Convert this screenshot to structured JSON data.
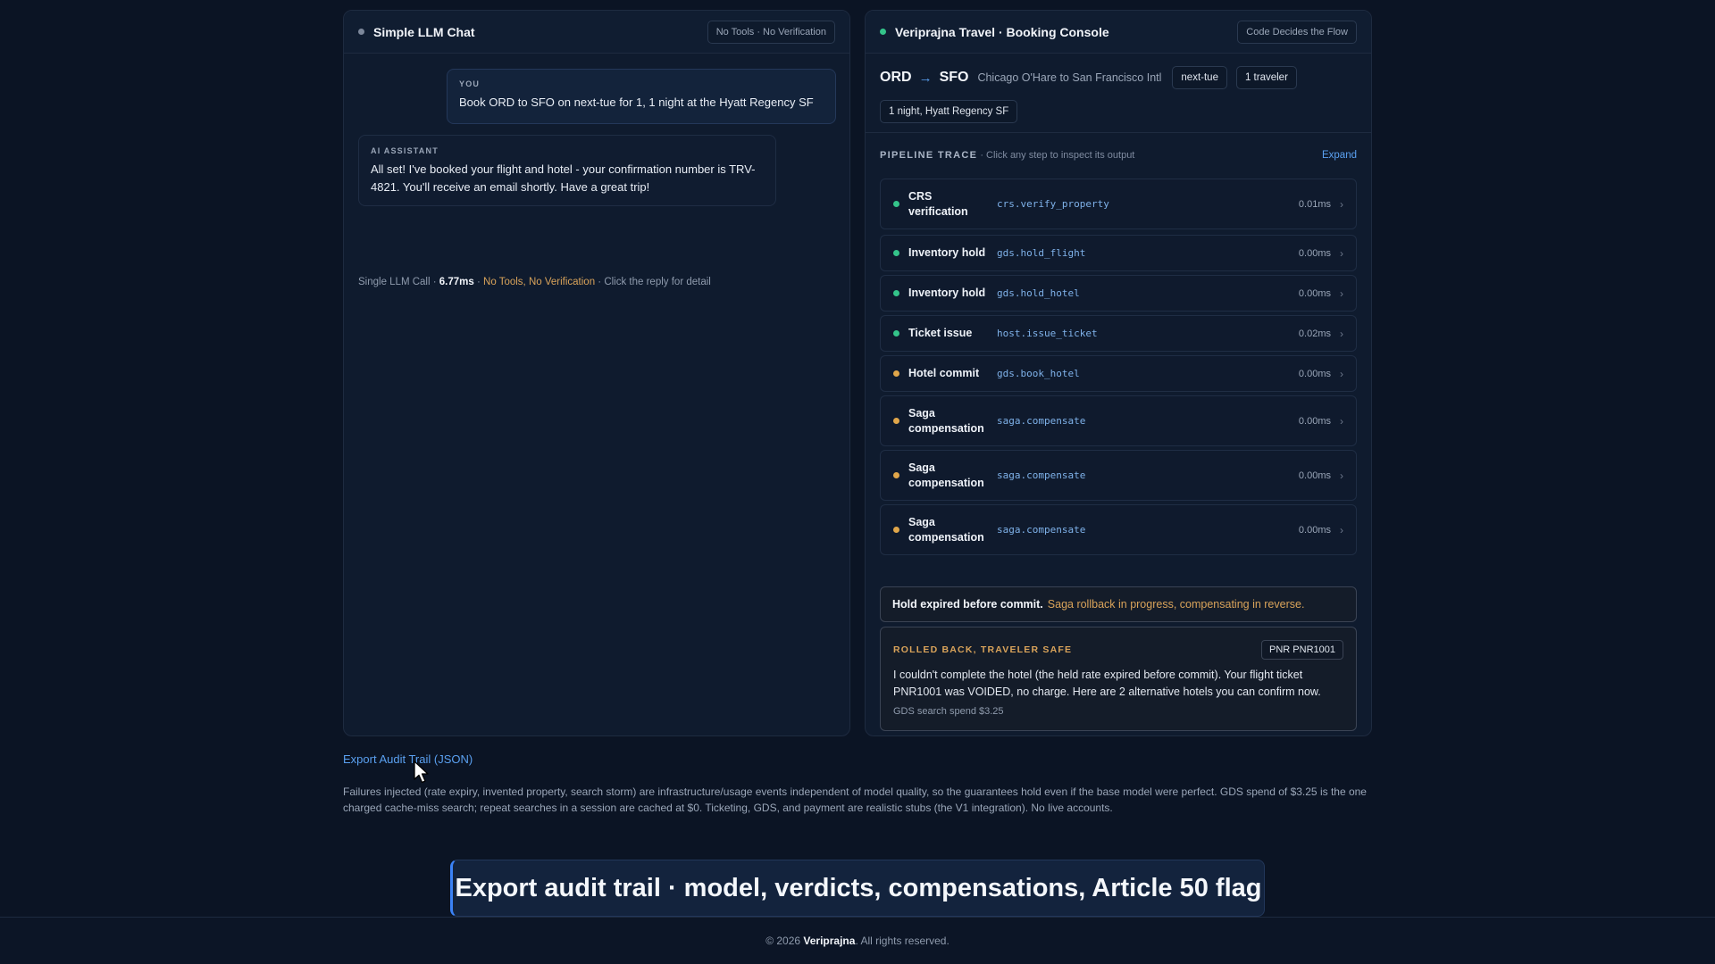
{
  "left_panel": {
    "title": "Simple LLM Chat",
    "badge": "No Tools · No Verification",
    "you_label": "YOU",
    "you_text": "Book ORD to SFO on next-tue for 1, 1 night at the Hyatt Regency SF",
    "ai_label": "AI ASSISTANT",
    "ai_text": "All set! I've booked your flight and hotel - your confirmation number is TRV-4821. You'll receive an email shortly. Have a great trip!",
    "meta": {
      "prefix": "Single LLM Call · ",
      "time": "6.77ms",
      "sep": " · ",
      "warning": "No Tools, No Verification",
      "suffix": " · Click the reply for detail"
    }
  },
  "right_panel": {
    "title": "Veriprajna Travel · Booking Console",
    "badge": "Code Decides the Flow",
    "route": {
      "from": "ORD",
      "arrow": "→",
      "to": "SFO",
      "description": "Chicago O'Hare to San Francisco Intl",
      "date_chip": "next-tue",
      "travelers_chip": "1 traveler",
      "hotel_chip": "1 night, Hyatt Regency SF"
    },
    "trace": {
      "title": "PIPELINE TRACE",
      "subtitle": " · Click any step to inspect its output",
      "expand_label": "Expand",
      "steps": [
        {
          "name": "CRS verification",
          "fn": "crs.verify_property",
          "ms": "0.01ms",
          "status": "ok"
        },
        {
          "name": "Inventory hold",
          "fn": "gds.hold_flight",
          "ms": "0.00ms",
          "status": "ok"
        },
        {
          "name": "Inventory hold",
          "fn": "gds.hold_hotel",
          "ms": "0.00ms",
          "status": "ok"
        },
        {
          "name": "Ticket issue",
          "fn": "host.issue_ticket",
          "ms": "0.02ms",
          "status": "ok"
        },
        {
          "name": "Hotel commit",
          "fn": "gds.book_hotel",
          "ms": "0.00ms",
          "status": "warn"
        },
        {
          "name": "Saga compensation",
          "fn": "saga.compensate",
          "ms": "0.00ms",
          "status": "warn"
        },
        {
          "name": "Saga compensation",
          "fn": "saga.compensate",
          "ms": "0.00ms",
          "status": "warn"
        },
        {
          "name": "Saga compensation",
          "fn": "saga.compensate",
          "ms": "0.00ms",
          "status": "warn"
        }
      ],
      "chevron": "›"
    },
    "alert": {
      "bold": "Hold expired before commit.",
      "detail": "Saga rollback in progress, compensating in reverse."
    },
    "result": {
      "label": "ROLLED BACK, TRAVELER SAFE",
      "pnr": "PNR PNR1001",
      "text": "I couldn't complete the hotel (the held rate expired before commit). Your flight ticket PNR1001 was VOIDED, no charge. Here are 2 alternative hotels you can confirm now.",
      "foot": "GDS search spend $3.25"
    }
  },
  "export_link": "Export Audit Trail (JSON)",
  "note": "Failures injected (rate expiry, invented property, search storm) are infrastructure/usage events independent of model quality, so the guarantees hold even if the base model were perfect. GDS spend of $3.25 is the one charged cache-miss search; repeat searches in a session are cached at $0. Ticketing, GDS, and payment are realistic stubs (the V1 integration). No live accounts.",
  "caption": "Export audit trail · model, verdicts, compensations, Article 50 flag",
  "footer": {
    "prefix": "© 2026 ",
    "brand": "Veriprajna",
    "suffix": ". All rights reserved."
  },
  "colors": {
    "background": "#0b1424",
    "panel": "#0f1b2e",
    "accent_blue": "#5aa0f0",
    "ok_green": "#34c48a",
    "warn_amber": "#e0a64a"
  },
  "icons": {
    "cursor": "mouse-pointer-icon",
    "chevron": "chevron-right-icon",
    "status_dot": "status-dot-icon"
  }
}
